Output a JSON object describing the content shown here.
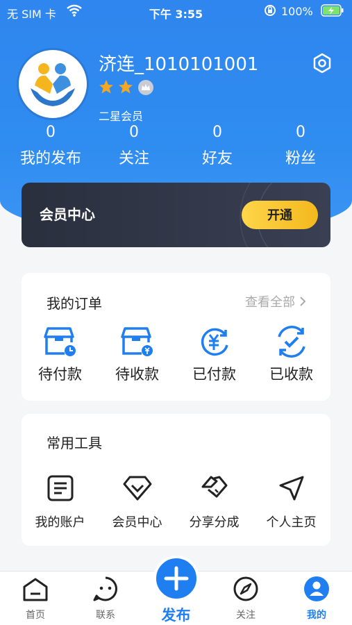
{
  "status_bar": {
    "carrier": "无 SIM 卡",
    "time": "下午 3:55",
    "battery": "100%"
  },
  "profile": {
    "username": "济连_1010101001",
    "level": "二星会员"
  },
  "stats": [
    {
      "value": "0",
      "label": "我的发布"
    },
    {
      "value": "0",
      "label": "关注"
    },
    {
      "value": "0",
      "label": "好友"
    },
    {
      "value": "0",
      "label": "粉丝"
    }
  ],
  "vip": {
    "title": "会员中心",
    "button": "开通"
  },
  "orders": {
    "title": "我的订单",
    "view_all": "查看全部",
    "items": [
      {
        "label": "待付款",
        "icon": "pending-payment-icon"
      },
      {
        "label": "待收款",
        "icon": "pending-receipt-icon"
      },
      {
        "label": "已付款",
        "icon": "paid-icon"
      },
      {
        "label": "已收款",
        "icon": "received-icon"
      }
    ]
  },
  "tools": {
    "title": "常用工具",
    "items": [
      {
        "label": "我的账户",
        "icon": "account-icon"
      },
      {
        "label": "会员中心",
        "icon": "vip-diamond-icon"
      },
      {
        "label": "分享分成",
        "icon": "handshake-icon"
      },
      {
        "label": "个人主页",
        "icon": "send-icon"
      }
    ]
  },
  "tabbar": {
    "home": "首页",
    "contact": "联系",
    "publish": "发布",
    "follow": "关注",
    "mine": "我的"
  },
  "colors": {
    "primary": "#1f7ff0",
    "header": "#2f86ee",
    "star": "#f5a623",
    "vip_button": "#f3b91d"
  }
}
